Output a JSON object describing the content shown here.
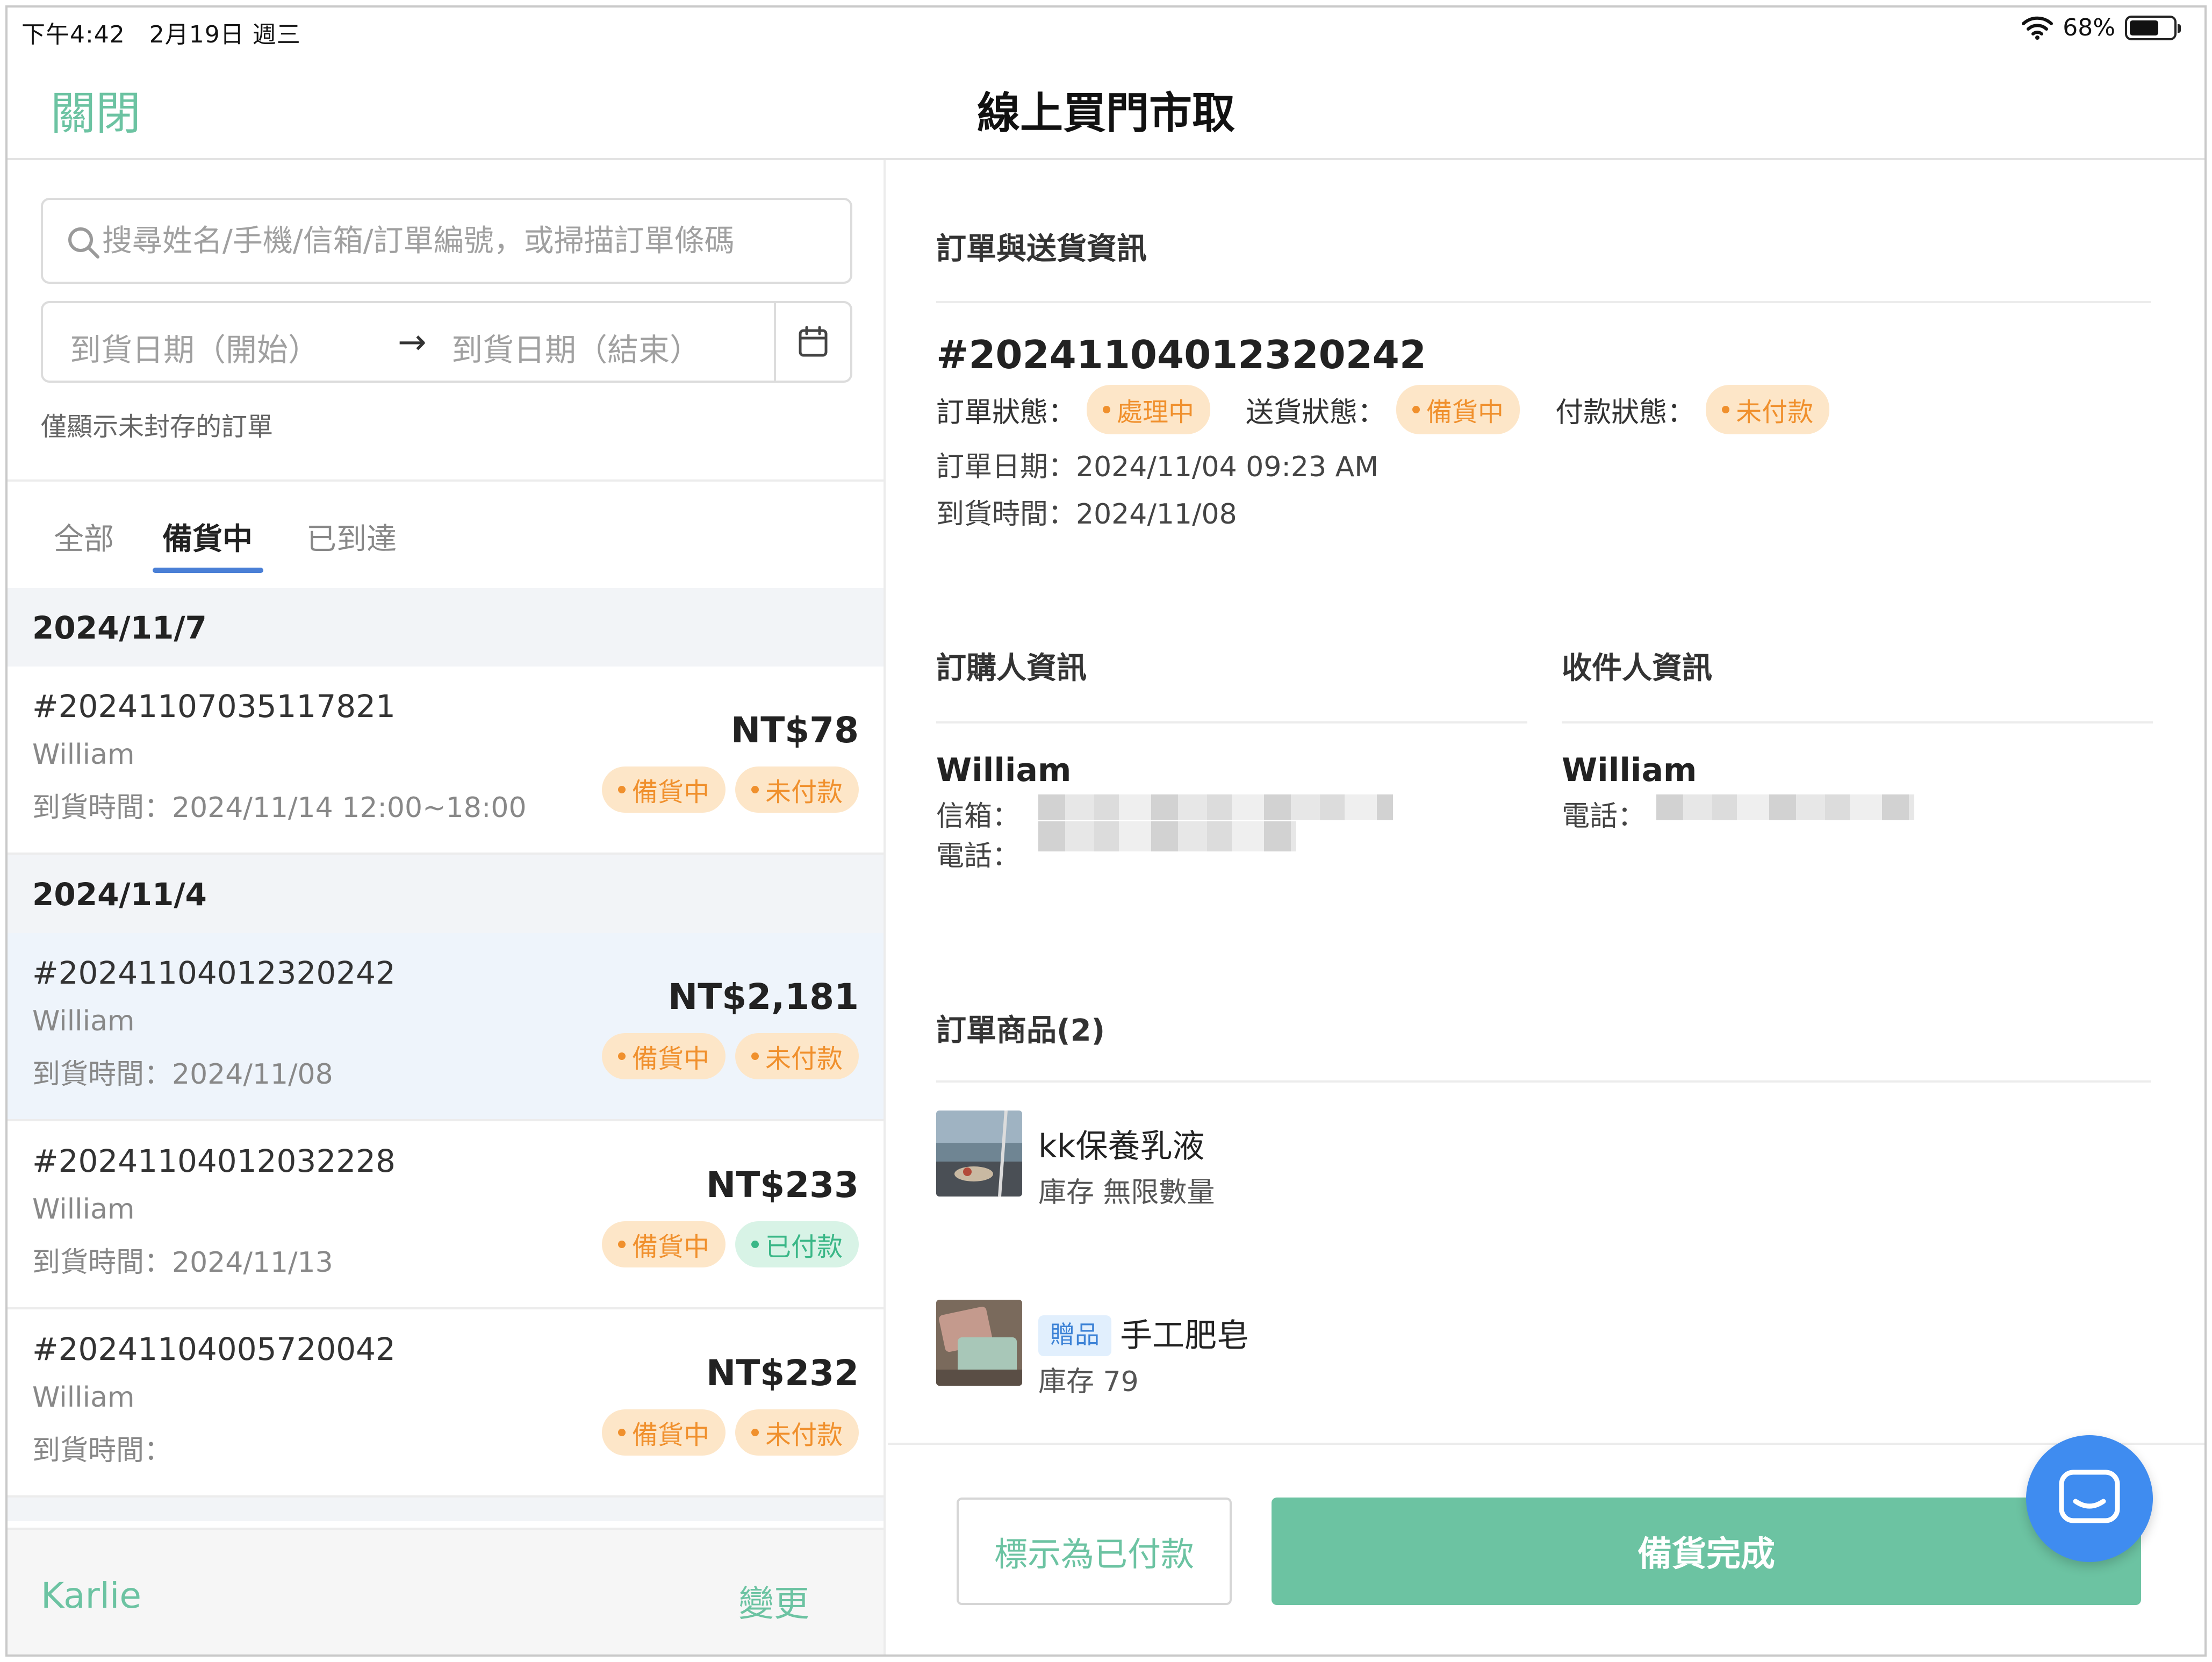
{
  "status_bar": {
    "time": "下午4:42",
    "date": "2月19日 週三",
    "battery": "68%",
    "battery_level": 0.68
  },
  "nav": {
    "close_label": "關閉",
    "title": "線上買門市取"
  },
  "left_panel": {
    "search_placeholder": "搜尋姓名/手機/信箱/訂單編號，或掃描訂單條碼",
    "date_start": "到貨日期（開始）",
    "date_arrow": "→",
    "date_end": "到貨日期（結束）",
    "only_unarchived": "僅顯示未封存的訂單",
    "tabs": [
      {
        "label": "全部",
        "active": false
      },
      {
        "label": "備貨中",
        "active": true
      },
      {
        "label": "已到達",
        "active": false
      }
    ],
    "groups": [
      {
        "date": "2024/11/7",
        "orders": [
          {
            "no": "#20241107035117821",
            "name": "William",
            "arrival": "到貨時間：2024/11/14 12:00~18:00",
            "amount": "NT$78",
            "prep": "備貨中",
            "pay": "未付款",
            "paid": false,
            "selected": false
          }
        ]
      },
      {
        "date": "2024/11/4",
        "orders": [
          {
            "no": "#20241104012320242",
            "name": "William",
            "arrival": "到貨時間：2024/11/08",
            "amount": "NT$2,181",
            "prep": "備貨中",
            "pay": "未付款",
            "paid": false,
            "selected": true
          },
          {
            "no": "#20241104012032228",
            "name": "William",
            "arrival": "到貨時間：2024/11/13",
            "amount": "NT$233",
            "prep": "備貨中",
            "pay": "已付款",
            "paid": true,
            "selected": false
          },
          {
            "no": "#20241104005720042",
            "name": "William",
            "arrival": "到貨時間：",
            "amount": "NT$232",
            "prep": "備貨中",
            "pay": "未付款",
            "paid": false,
            "selected": false
          }
        ]
      }
    ],
    "staff_name": "Karlie",
    "change_label": "變更"
  },
  "detail": {
    "order_section_title": "訂單與送貨資訊",
    "order_no": "#20241104012320242",
    "order_status_label": "訂單狀態：",
    "order_status": "處理中",
    "delivery_status_label": "送貨狀態：",
    "delivery_status": "備貨中",
    "payment_status_label": "付款狀態：",
    "payment_status": "未付款",
    "order_date": "訂單日期：2024/11/04 09:23 AM",
    "arrival_time": "到貨時間：2024/11/08",
    "buyer_title": "訂購人資訊",
    "buyer_name": "William",
    "buyer_email_label": "信箱：",
    "buyer_phone_label": "電話：",
    "receiver_title": "收件人資訊",
    "receiver_name": "William",
    "receiver_phone_label": "電話：",
    "items_title": "訂單商品(2)",
    "items": [
      {
        "name": "kk保養乳液",
        "stock": "庫存 無限數量",
        "gift_label": ""
      },
      {
        "name": "手工肥皂",
        "stock": "庫存 79",
        "gift_label": "贈品"
      }
    ],
    "mark_paid_label": "標示為已付款",
    "done_label": "備貨完成"
  },
  "colors": {
    "accent_green": "#6cc3a2",
    "tab_underline": "#4a7fd6",
    "warning": "#f0902d",
    "chat_button": "#3f8cf0"
  }
}
